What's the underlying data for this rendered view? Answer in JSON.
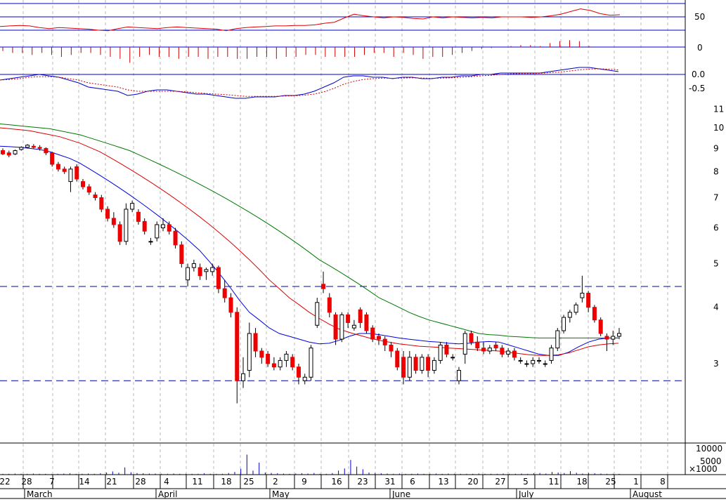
{
  "chart_data": [
    {
      "type": "line",
      "panel": "oscillator",
      "ytick_labels": [
        "50"
      ],
      "horizontal_lines": [
        50,
        25
      ],
      "colors": {
        "series": "#e00000",
        "guides": "#0000cc"
      },
      "series": [
        {
          "values": [
            32,
            33,
            34,
            33,
            30,
            28,
            30,
            29,
            28,
            27,
            25,
            24,
            28,
            31,
            30,
            29,
            28,
            30,
            31,
            30,
            29,
            28,
            27,
            24,
            28,
            30,
            31,
            32,
            33,
            33,
            34,
            34,
            35,
            38,
            40,
            48,
            55,
            52,
            50,
            48,
            50,
            49,
            47,
            46,
            50,
            48,
            50,
            49,
            48,
            49,
            48,
            50,
            50,
            50,
            49,
            50,
            52,
            55,
            60,
            65,
            62,
            56,
            53,
            54
          ]
        }
      ]
    },
    {
      "type": "bar",
      "panel": "histogram",
      "ytick_labels": [
        "0"
      ],
      "colors": {
        "bars": "#cc0000",
        "zero_line": "#0000cc"
      },
      "values": [
        -0.2,
        -0.3,
        -0.3,
        -0.4,
        -0.3,
        -0.4,
        -0.5,
        -0.4,
        -0.3,
        -0.3,
        -0.4,
        -0.5,
        -0.6,
        -0.8,
        -0.5,
        -0.4,
        -0.5,
        -0.5,
        -0.6,
        -0.5,
        -0.5,
        -0.6,
        -0.5,
        -0.5,
        -0.6,
        -0.6,
        -0.5,
        -0.5,
        -0.6,
        -0.5,
        -0.5,
        -0.4,
        -0.4,
        -0.5,
        -0.5,
        -0.5,
        -0.5,
        -0.4,
        -0.3,
        -0.3,
        -0.5,
        -0.3,
        -0.4,
        -0.6,
        -0.5,
        -0.5,
        -0.4,
        -0.3,
        -0.2,
        -0.1,
        -0.05,
        0,
        0.05,
        0.1,
        0.1,
        0.05,
        0.2,
        0.3,
        0.35,
        0.3,
        0.05,
        0,
        0,
        0
      ]
    },
    {
      "type": "line",
      "panel": "macd",
      "ytick_labels": [
        "0.0",
        "-0.5"
      ],
      "colors": {
        "macd": "#0000cc",
        "signal": "#cc0000",
        "zero_line": "#0000cc"
      },
      "series": [
        {
          "values": [
            -0.2,
            -0.15,
            -0.1,
            -0.05,
            0,
            -0.05,
            -0.1,
            -0.2,
            -0.3,
            -0.45,
            -0.5,
            -0.55,
            -0.6,
            -0.75,
            -0.7,
            -0.6,
            -0.55,
            -0.55,
            -0.6,
            -0.65,
            -0.7,
            -0.7,
            -0.75,
            -0.8,
            -0.85,
            -0.85,
            -0.8,
            -0.8,
            -0.8,
            -0.75,
            -0.75,
            -0.7,
            -0.6,
            -0.45,
            -0.3,
            -0.1,
            -0.05,
            -0.05,
            -0.1,
            -0.1,
            -0.15,
            -0.1,
            -0.1,
            -0.15,
            -0.15,
            -0.1,
            -0.1,
            -0.05,
            -0.05,
            0,
            0,
            0.05,
            0.05,
            0.05,
            0.05,
            0.05,
            0.1,
            0.15,
            0.2,
            0.25,
            0.25,
            0.2,
            0.15,
            0.1
          ]
        },
        {
          "values": [
            -0.2,
            -0.18,
            -0.15,
            -0.1,
            -0.08,
            -0.08,
            -0.1,
            -0.15,
            -0.2,
            -0.3,
            -0.35,
            -0.4,
            -0.45,
            -0.55,
            -0.6,
            -0.6,
            -0.6,
            -0.6,
            -0.6,
            -0.62,
            -0.65,
            -0.68,
            -0.7,
            -0.72,
            -0.75,
            -0.78,
            -0.78,
            -0.78,
            -0.78,
            -0.77,
            -0.76,
            -0.74,
            -0.7,
            -0.62,
            -0.5,
            -0.35,
            -0.25,
            -0.18,
            -0.15,
            -0.13,
            -0.14,
            -0.13,
            -0.12,
            -0.13,
            -0.14,
            -0.13,
            -0.12,
            -0.1,
            -0.08,
            -0.05,
            -0.03,
            0,
            0.02,
            0.03,
            0.03,
            0.04,
            0.06,
            0.08,
            0.12,
            0.16,
            0.19,
            0.2,
            0.19,
            0.16
          ]
        }
      ]
    },
    {
      "type": "candlestick",
      "panel": "price",
      "log_scale": true,
      "ytick_labels": [
        "11",
        "10",
        "9",
        "8",
        "7",
        "6",
        "5",
        "4",
        "3"
      ],
      "horizontal_lines": [
        4.45,
        2.75
      ],
      "colors": {
        "up": "#ffffff",
        "down": "#ee0000",
        "sma_short": "#0000dd",
        "sma_mid": "#dd0000",
        "sma_long": "#007700",
        "dashed_lines": "#0000aa"
      },
      "ohlc": [
        [
          8.9,
          9.0,
          8.7,
          8.75
        ],
        [
          8.8,
          8.9,
          8.6,
          8.7
        ],
        [
          8.75,
          8.95,
          8.7,
          8.9
        ],
        [
          8.95,
          9.1,
          8.9,
          9.05
        ],
        [
          9.05,
          9.2,
          9.0,
          9.15
        ],
        [
          9.1,
          9.2,
          9.0,
          9.05
        ],
        [
          9.05,
          9.15,
          8.9,
          9.0
        ],
        [
          9.0,
          9.05,
          8.7,
          8.8
        ],
        [
          8.8,
          8.85,
          8.2,
          8.3
        ],
        [
          8.3,
          8.4,
          8.0,
          8.1
        ],
        [
          8.1,
          8.2,
          7.9,
          8.0
        ],
        [
          7.6,
          8.2,
          7.2,
          8.1
        ],
        [
          8.2,
          8.3,
          7.6,
          7.7
        ],
        [
          7.6,
          7.7,
          7.3,
          7.4
        ],
        [
          7.4,
          7.5,
          7.1,
          7.2
        ],
        [
          7.1,
          7.2,
          6.9,
          7.0
        ],
        [
          7.0,
          7.1,
          6.5,
          6.6
        ],
        [
          6.6,
          6.7,
          6.2,
          6.3
        ],
        [
          6.3,
          6.5,
          6.0,
          6.1
        ],
        [
          6.1,
          6.2,
          5.5,
          5.6
        ],
        [
          5.6,
          6.8,
          5.5,
          6.6
        ],
        [
          6.6,
          6.9,
          6.5,
          6.8
        ],
        [
          6.5,
          6.6,
          6.1,
          6.2
        ],
        [
          6.2,
          6.3,
          5.8,
          5.9
        ],
        [
          5.6,
          5.7,
          5.5,
          5.6
        ],
        [
          5.7,
          6.2,
          5.6,
          6.1
        ],
        [
          6.0,
          6.3,
          5.9,
          6.1
        ],
        [
          6.1,
          6.2,
          5.8,
          5.9
        ],
        [
          5.9,
          6.0,
          5.4,
          5.5
        ],
        [
          5.5,
          5.6,
          4.9,
          5.0
        ],
        [
          4.6,
          5.0,
          4.45,
          4.9
        ],
        [
          4.9,
          5.1,
          4.8,
          5.0
        ],
        [
          4.9,
          5.0,
          4.6,
          4.7
        ],
        [
          4.8,
          4.9,
          4.6,
          4.85
        ],
        [
          4.8,
          5.0,
          4.7,
          4.9
        ],
        [
          4.9,
          4.95,
          4.3,
          4.4
        ],
        [
          4.4,
          4.6,
          4.1,
          4.2
        ],
        [
          4.2,
          4.3,
          3.8,
          3.9
        ],
        [
          3.9,
          4.0,
          2.45,
          2.75
        ],
        [
          2.75,
          3.1,
          2.65,
          2.85
        ],
        [
          2.9,
          3.7,
          2.8,
          3.5
        ],
        [
          3.5,
          3.6,
          3.1,
          3.2
        ],
        [
          3.2,
          3.25,
          3.0,
          3.1
        ],
        [
          3.15,
          3.2,
          2.95,
          3.0
        ],
        [
          3.0,
          3.1,
          2.9,
          2.95
        ],
        [
          2.95,
          3.1,
          2.9,
          3.05
        ],
        [
          3.05,
          3.2,
          2.95,
          3.15
        ],
        [
          3.1,
          3.15,
          2.9,
          2.95
        ],
        [
          2.95,
          3.0,
          2.7,
          2.8
        ],
        [
          2.75,
          2.85,
          2.7,
          2.8
        ],
        [
          2.8,
          3.3,
          2.75,
          3.25
        ],
        [
          3.65,
          4.2,
          3.6,
          4.1
        ],
        [
          4.5,
          4.8,
          4.3,
          4.4
        ],
        [
          4.2,
          4.3,
          3.8,
          3.9
        ],
        [
          3.85,
          3.9,
          3.3,
          3.4
        ],
        [
          3.4,
          3.9,
          3.35,
          3.85
        ],
        [
          3.85,
          3.9,
          3.6,
          3.7
        ],
        [
          3.6,
          3.75,
          3.55,
          3.65
        ],
        [
          3.95,
          4.0,
          3.6,
          3.7
        ],
        [
          3.85,
          3.9,
          3.5,
          3.55
        ],
        [
          3.6,
          3.65,
          3.35,
          3.4
        ],
        [
          3.45,
          3.5,
          3.3,
          3.4
        ],
        [
          3.4,
          3.45,
          3.2,
          3.3
        ],
        [
          3.3,
          3.35,
          3.1,
          3.2
        ],
        [
          3.2,
          3.25,
          2.9,
          2.95
        ],
        [
          3.1,
          3.2,
          2.7,
          2.8
        ],
        [
          2.8,
          3.2,
          2.75,
          3.1
        ],
        [
          3.1,
          3.15,
          2.85,
          2.9
        ],
        [
          2.9,
          3.15,
          2.85,
          3.1
        ],
        [
          3.1,
          3.15,
          2.8,
          2.9
        ],
        [
          2.9,
          3.1,
          2.85,
          3.05
        ],
        [
          3.05,
          3.35,
          3.0,
          3.3
        ],
        [
          3.3,
          3.35,
          3.1,
          3.15
        ],
        [
          3.1,
          3.15,
          3.05,
          3.1
        ],
        [
          2.75,
          2.95,
          2.7,
          2.9
        ],
        [
          3.15,
          3.55,
          3.0,
          3.5
        ],
        [
          3.5,
          3.55,
          3.3,
          3.35
        ],
        [
          3.35,
          3.45,
          3.2,
          3.25
        ],
        [
          3.25,
          3.35,
          3.15,
          3.2
        ],
        [
          3.2,
          3.3,
          3.15,
          3.25
        ],
        [
          3.3,
          3.35,
          3.2,
          3.25
        ],
        [
          3.25,
          3.3,
          3.1,
          3.15
        ],
        [
          3.15,
          3.25,
          3.1,
          3.2
        ],
        [
          3.2,
          3.25,
          3.05,
          3.1
        ],
        [
          3.05,
          3.1,
          3.0,
          3.05
        ],
        [
          3.0,
          3.05,
          2.95,
          3.0
        ],
        [
          3.0,
          3.1,
          2.95,
          3.05
        ],
        [
          3.05,
          3.1,
          3.0,
          3.05
        ],
        [
          3.0,
          3.05,
          2.95,
          3.0
        ],
        [
          3.05,
          3.3,
          3.0,
          3.25
        ],
        [
          3.25,
          3.6,
          3.2,
          3.55
        ],
        [
          3.55,
          3.85,
          3.5,
          3.8
        ],
        [
          3.8,
          3.95,
          3.7,
          3.9
        ],
        [
          3.9,
          4.1,
          3.85,
          4.05
        ],
        [
          4.2,
          4.7,
          4.1,
          4.3
        ],
        [
          4.3,
          4.35,
          3.9,
          4.0
        ],
        [
          4.0,
          4.05,
          3.7,
          3.75
        ],
        [
          3.75,
          3.8,
          3.45,
          3.5
        ],
        [
          3.45,
          3.5,
          3.2,
          3.4
        ],
        [
          3.4,
          3.55,
          3.3,
          3.45
        ],
        [
          3.45,
          3.6,
          3.4,
          3.5
        ]
      ],
      "series": [
        {
          "values": [
            9.1,
            9.08,
            9.05,
            9.0,
            8.95,
            8.85,
            8.7,
            8.55,
            8.35,
            8.1,
            7.85,
            7.6,
            7.35,
            7.1,
            6.85,
            6.6,
            6.35,
            6.1,
            5.85,
            5.6,
            5.35,
            5.05,
            4.75,
            4.45,
            4.15,
            3.9,
            3.75,
            3.6,
            3.5,
            3.45,
            3.4,
            3.35,
            3.32,
            3.33,
            3.38,
            3.45,
            3.5,
            3.5,
            3.48,
            3.45,
            3.42,
            3.4,
            3.38,
            3.36,
            3.35,
            3.33,
            3.32,
            3.33,
            3.35,
            3.36,
            3.35,
            3.3,
            3.25,
            3.2,
            3.15,
            3.13,
            3.13,
            3.18,
            3.27,
            3.35,
            3.4,
            3.42,
            3.42
          ]
        },
        {
          "values": [
            10.0,
            9.95,
            9.9,
            9.85,
            9.75,
            9.65,
            9.55,
            9.4,
            9.25,
            9.05,
            8.85,
            8.6,
            8.35,
            8.1,
            7.85,
            7.6,
            7.35,
            7.1,
            6.85,
            6.6,
            6.35,
            6.1,
            5.85,
            5.6,
            5.35,
            5.1,
            4.85,
            4.6,
            4.4,
            4.2,
            4.05,
            3.9,
            3.78,
            3.67,
            3.58,
            3.52,
            3.47,
            3.42,
            3.38,
            3.35,
            3.32,
            3.3,
            3.28,
            3.27,
            3.26,
            3.25,
            3.24,
            3.23,
            3.22,
            3.21,
            3.2,
            3.18,
            3.16,
            3.14,
            3.13,
            3.13,
            3.14,
            3.17,
            3.22,
            3.27,
            3.3,
            3.32,
            3.33
          ]
        },
        {
          "values": [
            10.2,
            10.15,
            10.1,
            10.05,
            10.0,
            9.95,
            9.85,
            9.75,
            9.65,
            9.5,
            9.35,
            9.2,
            9.05,
            8.9,
            8.7,
            8.5,
            8.3,
            8.1,
            7.9,
            7.7,
            7.5,
            7.3,
            7.1,
            6.9,
            6.7,
            6.5,
            6.3,
            6.1,
            5.9,
            5.7,
            5.5,
            5.3,
            5.1,
            4.95,
            4.8,
            4.65,
            4.5,
            4.35,
            4.2,
            4.1,
            4.0,
            3.9,
            3.82,
            3.75,
            3.7,
            3.65,
            3.6,
            3.55,
            3.5,
            3.48,
            3.47,
            3.45,
            3.44,
            3.43,
            3.42,
            3.42,
            3.42,
            3.42,
            3.42,
            3.42,
            3.42,
            3.42,
            3.42
          ]
        }
      ]
    },
    {
      "type": "bar",
      "panel": "volume",
      "ytick_labels": [
        "10000",
        "5000"
      ],
      "unit_label": "×1000",
      "colors": {
        "bars": "#0000cc"
      },
      "values": [
        300,
        300,
        400,
        300,
        300,
        400,
        300,
        300,
        200,
        300,
        400,
        500,
        300,
        300,
        400,
        300,
        500,
        800,
        1200,
        700,
        2700,
        900,
        600,
        500,
        400,
        400,
        300,
        300,
        400,
        300,
        300,
        300,
        300,
        500,
        300,
        300,
        300,
        600,
        1000,
        2200,
        7500,
        1500,
        4500,
        800,
        600,
        500,
        400,
        300,
        400,
        500,
        400,
        600,
        300,
        300,
        600,
        1500,
        2300,
        5500,
        3000,
        2000,
        800,
        600,
        500,
        400,
        300,
        400,
        300,
        300,
        400,
        300,
        300,
        400,
        300,
        400,
        300,
        300,
        300,
        300,
        400,
        300,
        300,
        300,
        400,
        300,
        300,
        400,
        300,
        500,
        600,
        400,
        1000,
        800,
        600,
        1300,
        700,
        400,
        600,
        500,
        400,
        300,
        300,
        300
      ]
    }
  ],
  "x_axis": {
    "day_ticks": [
      "22",
      "28",
      "7",
      "14",
      "21",
      "28",
      "4",
      "11",
      "18",
      "25",
      "2",
      "9",
      "16",
      "23",
      "31",
      "6",
      "13",
      "20",
      "27",
      "5",
      "11",
      "18",
      "25",
      "1",
      "8"
    ],
    "months": [
      "March",
      "April",
      "May",
      "June",
      "July",
      "August"
    ]
  }
}
